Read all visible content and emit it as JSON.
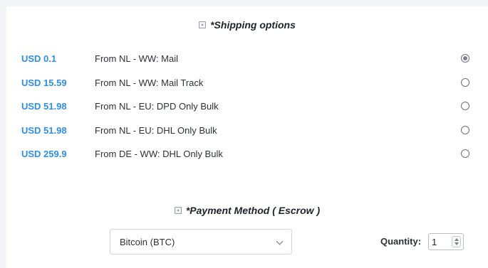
{
  "shipping": {
    "title": "*Shipping options",
    "options": [
      {
        "price": "USD 0.1",
        "label": "From NL - WW: Mail",
        "selected": true
      },
      {
        "price": "USD 15.59",
        "label": "From NL - WW: Mail Track",
        "selected": false
      },
      {
        "price": "USD 51.98",
        "label": "From NL - EU: DPD Only Bulk",
        "selected": false
      },
      {
        "price": "USD 51.98",
        "label": "From NL - EU: DHL Only Bulk",
        "selected": false
      },
      {
        "price": "USD 259.9",
        "label": "From DE - WW: DHL Only Bulk",
        "selected": false
      }
    ]
  },
  "payment": {
    "title": "*Payment Method ( Escrow )",
    "selected": "Bitcoin (BTC)"
  },
  "quantity": {
    "label": "Quantity:",
    "value": "1"
  },
  "colors": {
    "price": "#2e8fe8",
    "text": "#2d3136",
    "background": "#ffffff"
  }
}
